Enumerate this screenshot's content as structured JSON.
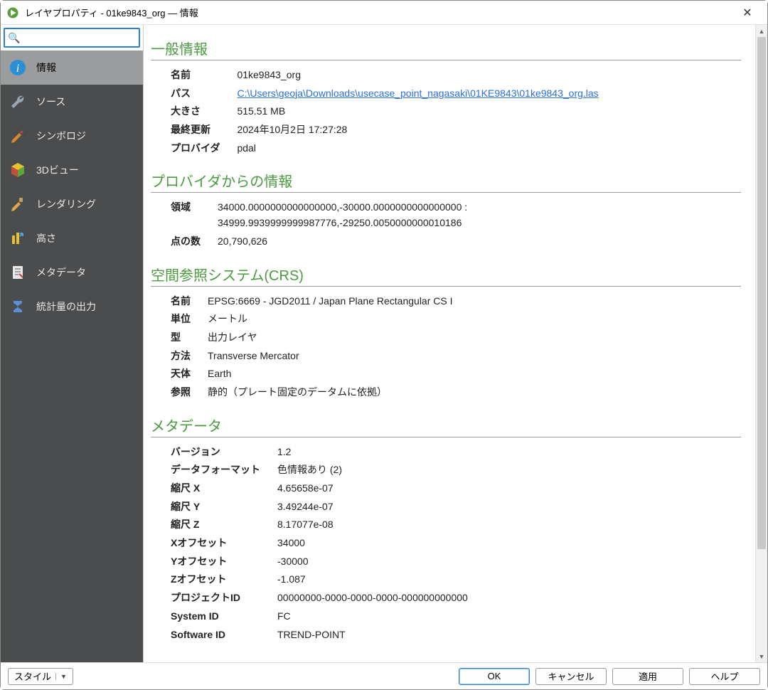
{
  "window": {
    "title": "レイヤプロパティ - 01ke9843_org — 情報"
  },
  "search": {
    "placeholder": ""
  },
  "nav": {
    "items": [
      {
        "label": "情報"
      },
      {
        "label": "ソース"
      },
      {
        "label": "シンボロジ"
      },
      {
        "label": "3Dビュー"
      },
      {
        "label": "レンダリング"
      },
      {
        "label": "高さ"
      },
      {
        "label": "メタデータ"
      },
      {
        "label": "統計量の出力"
      }
    ]
  },
  "sections": {
    "general": {
      "title": "一般情報",
      "name_k": "名前",
      "name_v": "01ke9843_org",
      "path_k": "パス",
      "path_v": "C:\\Users\\geoja\\Downloads\\usecase_point_nagasaki\\01KE9843\\01ke9843_org.las",
      "size_k": "大きさ",
      "size_v": "515.51 MB",
      "updated_k": "最終更新",
      "updated_v": "2024年10月2日 17:27:28",
      "provider_k": "プロバイダ",
      "provider_v": "pdal"
    },
    "provider": {
      "title": "プロバイダからの情報",
      "extent_k": "領域",
      "extent_v1": "34000.0000000000000000,-30000.0000000000000000 :",
      "extent_v2": "34999.9939999999987776,-29250.0050000000010186",
      "count_k": "点の数",
      "count_v": "20,790,626"
    },
    "crs": {
      "title": "空間参照システム(CRS)",
      "name_k": "名前",
      "name_v": "EPSG:6669 - JGD2011 / Japan Plane Rectangular CS I",
      "unit_k": "単位",
      "unit_v": "メートル",
      "type_k": "型",
      "type_v": "出力レイヤ",
      "method_k": "方法",
      "method_v": "Transverse Mercator",
      "body_k": "天体",
      "body_v": "Earth",
      "ref_k": "参照",
      "ref_v": "静的（プレート固定のデータムに依拠）"
    },
    "meta": {
      "title": "メタデータ",
      "version_k": "バージョン",
      "version_v": "1.2",
      "format_k": "データフォーマット",
      "format_v": "色情報あり (2)",
      "sx_k": "縮尺 X",
      "sx_v": "4.65658e-07",
      "sy_k": "縮尺 Y",
      "sy_v": "3.49244e-07",
      "sz_k": "縮尺 Z",
      "sz_v": "8.17077e-08",
      "ox_k": "Xオフセット",
      "ox_v": "34000",
      "oy_k": "Yオフセット",
      "oy_v": "-30000",
      "oz_k": "Zオフセット",
      "oz_v": "-1.087",
      "proj_k": "プロジェクトID",
      "proj_v": "00000000-0000-0000-0000-000000000000",
      "sys_k": "System ID",
      "sys_v": "FC",
      "soft_k": "Software ID",
      "soft_v": "TREND-POINT"
    }
  },
  "footer": {
    "style": "スタイル",
    "ok": "OK",
    "cancel": "キャンセル",
    "apply": "適用",
    "help": "ヘルプ"
  }
}
